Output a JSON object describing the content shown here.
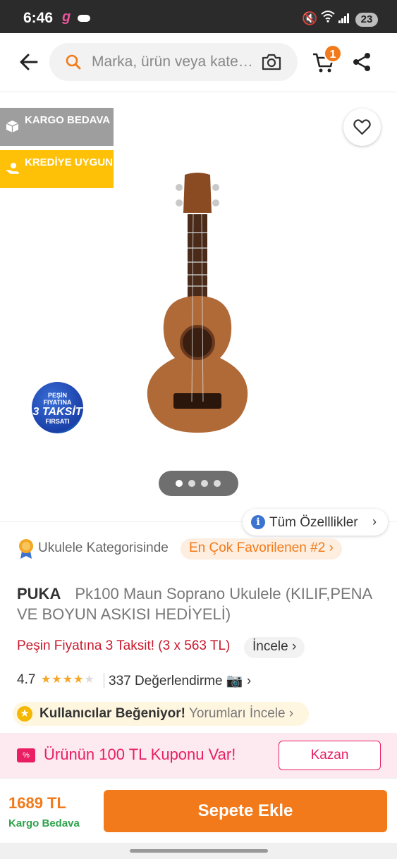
{
  "status_bar": {
    "time": "6:46",
    "app_icon": "g",
    "battery": "23"
  },
  "search": {
    "placeholder": "Marka, ürün veya kategori ara"
  },
  "cart": {
    "count": "1"
  },
  "badges": {
    "kargo": "KARGO BEDAVA",
    "kredi": "KREDİYE UYGUN"
  },
  "promo_sticker": {
    "line1": "PEŞİN",
    "line2": "FIYATINA",
    "line3": "3 TAKSİT",
    "line4": "FIRSATI"
  },
  "features_button": "Tüm Özelllikler",
  "ranking": {
    "category_text": "Ukulele Kategorisinde",
    "badge": "En Çok Favorilenen #2"
  },
  "product": {
    "brand": "PUKA",
    "name": "Pk100 Maun Soprano Ukulele (KILIF,PENA VE BOYUN ASKISI HEDİYELİ)"
  },
  "installment": {
    "text": "Peşin Fiyatına 3 Taksit! (3 x 563 TL)",
    "link": "İncele"
  },
  "rating": {
    "score": "4.7",
    "count": "337 Değerlendirme",
    "stars": 4.5
  },
  "liked": {
    "title": "Kullanıcılar Beğeniyor!",
    "link": "Yorumları İncele"
  },
  "coupon": {
    "text": "Ürünün 100 TL Kuponu Var!",
    "button": "Kazan"
  },
  "footer": {
    "price": "1689 TL",
    "shipping": "Kargo Bedava",
    "add_button": "Sepete Ekle"
  },
  "colors": {
    "brand_orange": "#f27a1a",
    "coupon_pink": "#e91e63",
    "kredi_yellow": "#ffc107",
    "shipping_green": "#2ea24c"
  }
}
